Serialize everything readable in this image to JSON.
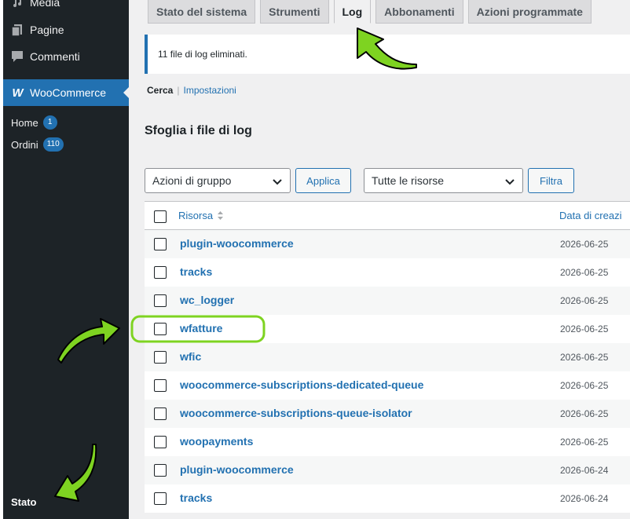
{
  "sidebar": {
    "items": [
      {
        "label": "Media",
        "icon": "media-icon"
      },
      {
        "label": "Pagine",
        "icon": "page-icon"
      },
      {
        "label": "Commenti",
        "icon": "comment-icon"
      },
      {
        "label": "WooCommerce",
        "icon": "woocommerce-icon"
      }
    ],
    "woo_logo_text": "W",
    "submenu": [
      {
        "label": "Home",
        "badge": "1"
      },
      {
        "label": "Ordini",
        "badge": "110"
      }
    ],
    "bottom_label": "Stato"
  },
  "tabs": [
    {
      "label": "Stato del sistema",
      "active": false
    },
    {
      "label": "Strumenti",
      "active": false
    },
    {
      "label": "Log",
      "active": true
    },
    {
      "label": "Abbonamenti",
      "active": false
    },
    {
      "label": "Azioni programmate",
      "active": false
    }
  ],
  "notice": {
    "text": "11 file di log eliminati."
  },
  "subnav": {
    "current": "Cerca",
    "separator": "|",
    "link": "Impostazioni"
  },
  "section_title": "Sfoglia i file di log",
  "controls": {
    "bulk_actions": "Azioni di gruppo",
    "apply": "Applica",
    "sources": "Tutte le risorse",
    "filter": "Filtra"
  },
  "table": {
    "col_source": "Risorsa",
    "col_date": "Data di creazi",
    "rows": [
      {
        "name": "plugin-woocommerce",
        "date": "2026-06-25"
      },
      {
        "name": "tracks",
        "date": "2026-06-25"
      },
      {
        "name": "wc_logger",
        "date": "2026-06-25"
      },
      {
        "name": "wfatture",
        "date": "2026-06-25"
      },
      {
        "name": "wfic",
        "date": "2026-06-25"
      },
      {
        "name": "woocommerce-subscriptions-dedicated-queue",
        "date": "2026-06-25"
      },
      {
        "name": "woocommerce-subscriptions-queue-isolator",
        "date": "2026-06-25"
      },
      {
        "name": "woopayments",
        "date": "2026-06-25"
      },
      {
        "name": "plugin-woocommerce",
        "date": "2026-06-24"
      },
      {
        "name": "tracks",
        "date": "2026-06-24"
      }
    ]
  },
  "colors": {
    "sidebar_bg": "#1d2327",
    "accent": "#2271b1",
    "annotation_green": "#7ed321"
  }
}
